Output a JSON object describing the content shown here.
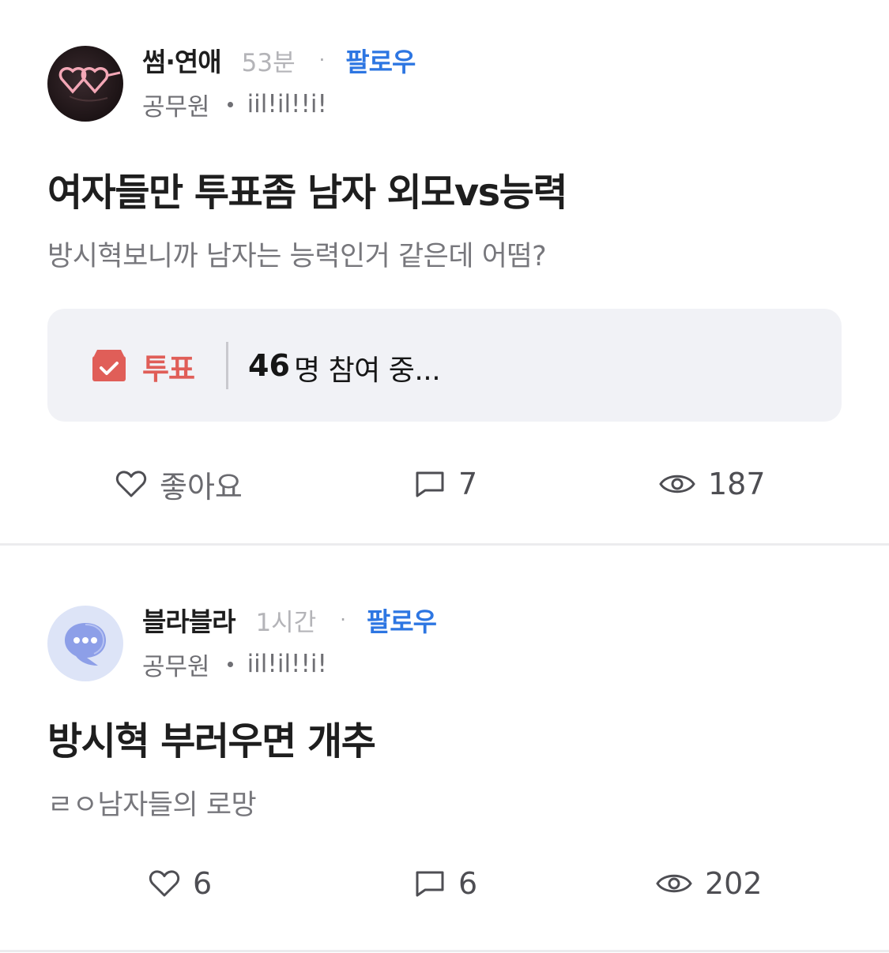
{
  "posts": [
    {
      "board": "썸·연애",
      "time": "53분",
      "follow": "팔로우",
      "job": "공무원",
      "nickname": "iil!il!!i!",
      "title": "여자들만 투표좀 남자 외모vs능력",
      "body": "방시혁보니까 남자는 능력인거 같은데 어떰?",
      "vote": {
        "label": "투표",
        "count": "46",
        "suffix": "명 참여 중..."
      },
      "likes": "좋아요",
      "comments": "7",
      "views": "187",
      "avatar_icon": "heart-glasses-icon"
    },
    {
      "board": "블라블라",
      "time": "1시간",
      "follow": "팔로우",
      "job": "공무원",
      "nickname": "iil!il!!i!",
      "title": "방시혁 부러우면 개추",
      "body": "ㄹㅇ남자들의 로망",
      "likes": "6",
      "comments": "6",
      "views": "202",
      "avatar_icon": "chat-bubble-icon"
    }
  ],
  "colors": {
    "accent": "#2d76e2",
    "vote": "#e05e58",
    "muted": "#77777c",
    "vote_bg": "#f1f2f6"
  }
}
